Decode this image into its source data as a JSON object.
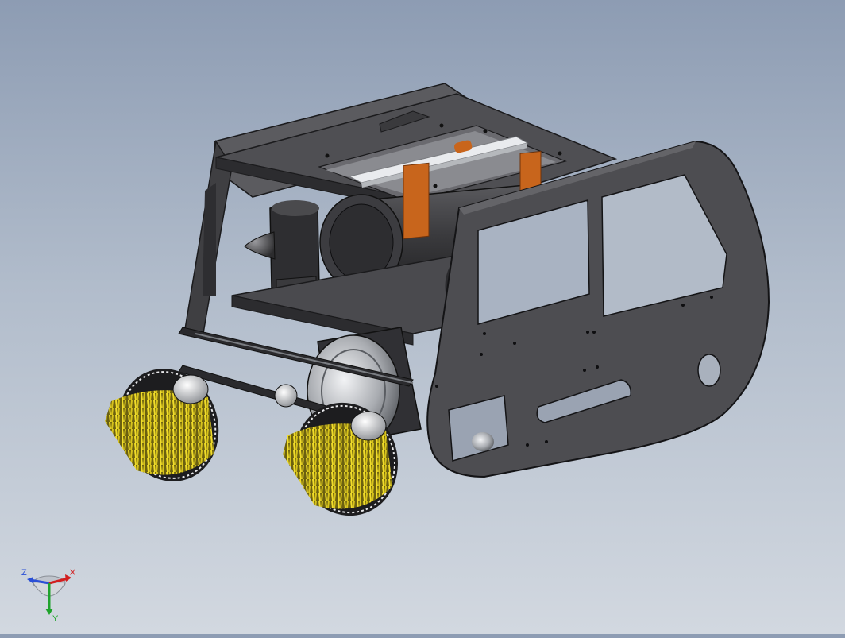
{
  "viewport": {
    "background_top": "#8d9cb3",
    "background_bottom": "#d2d8e0",
    "model": {
      "name": "",
      "colors": {
        "frame": "#4a4a4d",
        "frame_dark": "#2f2f32",
        "frame_edge": "#1b1b1d",
        "copper": "#c8651c",
        "brush_bristle": "#e6d21e",
        "servo_red": "#d8151a",
        "steel": "#cfd2d6"
      }
    }
  },
  "triad": {
    "x_label": "X",
    "y_label": "Y",
    "z_label": "Z",
    "x_color": "#d21f1f",
    "y_color": "#1fa32c",
    "z_color": "#2a4fd6"
  }
}
